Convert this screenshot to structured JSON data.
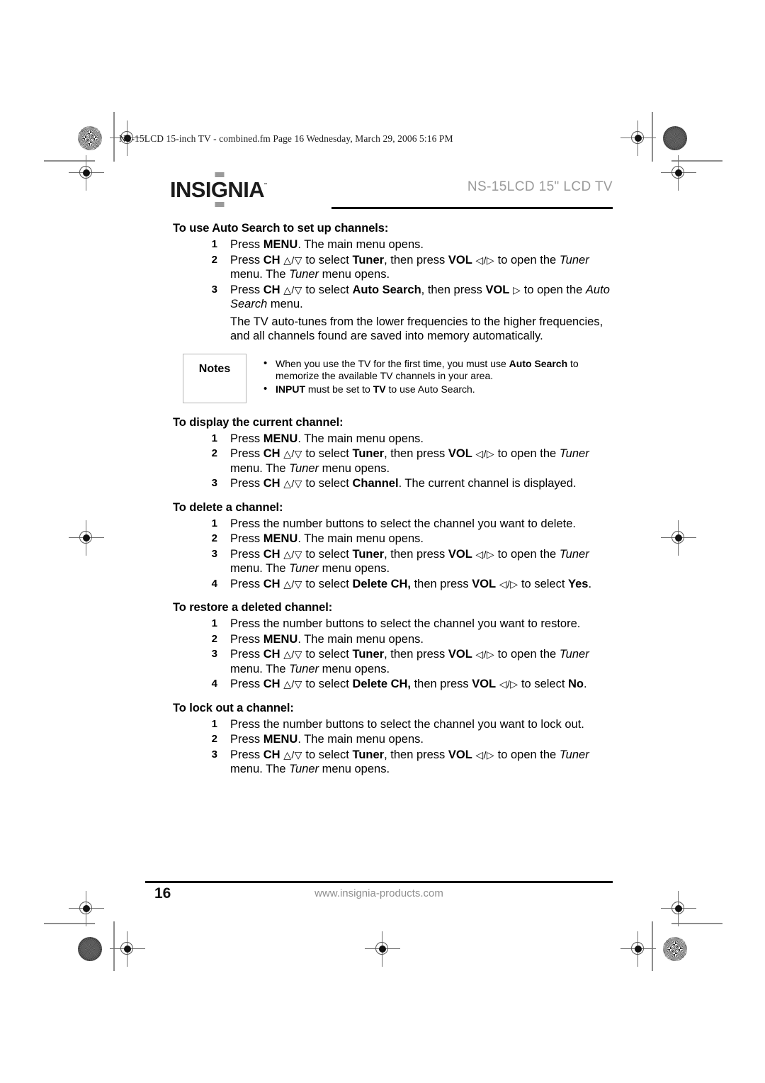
{
  "print_header": {
    "file_line": "NS-15LCD 15-inch TV - combined.fm  Page 16  Wednesday, March 29, 2006  5:16 PM"
  },
  "masthead": {
    "logo_part1": "INSI",
    "logo_g": "G",
    "logo_part2": "NIA",
    "logo_tm": "˜",
    "model_title": "NS-15LCD 15\" LCD TV"
  },
  "sections": [
    {
      "heading": "To use Auto Search to set up channels:",
      "steps": [
        "1_menu",
        "2_tuner",
        "3_autosearch"
      ],
      "paragraph": "The TV auto-tunes from the lower frequencies to the higher frequencies, and all channels found are saved into memory automatically."
    },
    {
      "heading": "To display the current channel:"
    },
    {
      "heading": "To delete a channel:"
    },
    {
      "heading": "To restore a deleted channel:"
    },
    {
      "heading": "To lock out a channel:"
    }
  ],
  "headings": {
    "auto_search": "To use Auto Search to set up channels:",
    "display_channel": "To display the current channel:",
    "delete_channel": "To delete a channel:",
    "restore_channel": "To restore a deleted channel:",
    "lock_channel": "To lock out a channel:"
  },
  "labels": {
    "press": "Press ",
    "menu": "MENU",
    "menu_tail": ". The main menu opens.",
    "ch": "CH",
    "vol": "VOL",
    "to_select": " to select ",
    "then_press": ", then press ",
    "then_press_nocomma": " then press ",
    "to_open_the": " to open the",
    "to_open": " to open",
    "tuner": "Tuner",
    "tuner_menu_line": " menu. The ",
    "tuner_menu_opens": " menu opens.",
    "auto_search_bold": "Auto Search",
    "the_word": "the ",
    "auto_search_italic": "Auto Search",
    "menu_period": " menu.",
    "channel_bold": "Channel",
    "channel_tail": ". The current channel is displayed.",
    "number_buttons_delete": "Press the number buttons to select the channel you want to delete.",
    "number_buttons_restore": "Press the number buttons to select the channel you want to restore.",
    "number_buttons_lock": "Press the number buttons to select the channel you want to lock out.",
    "delete_ch_bold": "Delete CH,",
    "to_select_word": " to",
    "select_word": "select ",
    "yes": "Yes",
    "no": "No",
    "period": "."
  },
  "arrows": {
    "up": "△",
    "down": "▽",
    "left": "◁",
    "right": "▷",
    "slash": "/"
  },
  "notes": {
    "label": "Notes",
    "items": [
      {
        "pre": "When you use the TV for the first time, you must use ",
        "bold": "Auto Search",
        "post": " to memorize the available TV channels in your area."
      },
      {
        "pre": "",
        "bold": "INPUT",
        "mid": " must be set to ",
        "bold2": "TV",
        "post": " to use Auto Search."
      }
    ]
  },
  "footer": {
    "page_number": "16",
    "url": "www.insignia-products.com"
  },
  "colors": {
    "title_gray": "#9a9a9a",
    "rule_black": "#000000",
    "notes_border": "#b5b5b5",
    "url_gray": "#8f8f8f"
  }
}
